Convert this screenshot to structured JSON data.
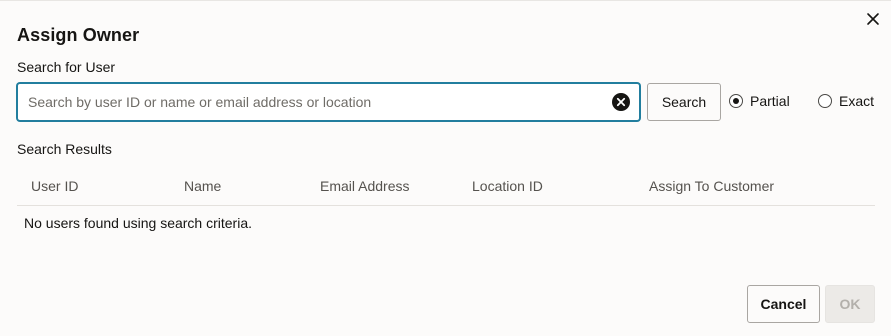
{
  "dialog": {
    "title": "Assign Owner",
    "close_icon": "close-icon"
  },
  "search": {
    "label": "Search for User",
    "placeholder": "Search by user ID or name or email address or location",
    "value": "",
    "clear_icon": "clear-circle-icon",
    "button_label": "Search",
    "mode_options": [
      {
        "label": "Partial",
        "checked": true
      },
      {
        "label": "Exact",
        "checked": false
      }
    ]
  },
  "results": {
    "label": "Search Results",
    "columns": [
      "User ID",
      "Name",
      "Email Address",
      "Location ID",
      "Assign To Customer"
    ],
    "empty_message": "No users found using search criteria."
  },
  "footer": {
    "cancel_label": "Cancel",
    "ok_label": "OK"
  },
  "colors": {
    "focus_border": "#227e9e",
    "background": "#fcfbfa"
  }
}
